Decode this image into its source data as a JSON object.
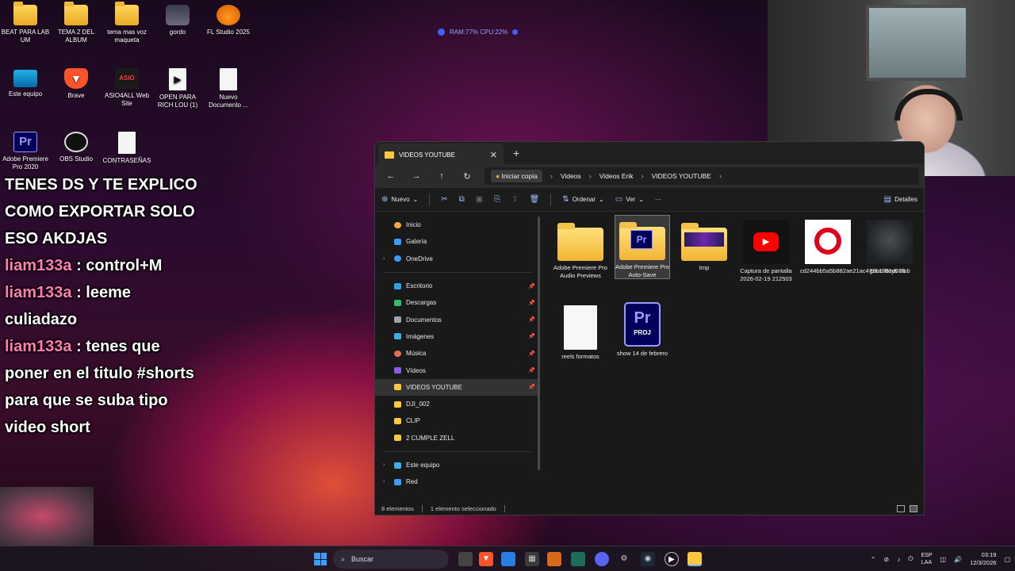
{
  "desktop": {
    "icons": [
      {
        "label": "BEAT PARA LAB UM"
      },
      {
        "label": "TEMA 2 DEL ALBUM"
      },
      {
        "label": "tema mas voz maqueta"
      },
      {
        "label": "gordo"
      },
      {
        "label": "FL Studio 2025"
      },
      {
        "label": "Este equipo"
      },
      {
        "label": "Brave"
      },
      {
        "label": "ASIO4ALL Web Site"
      },
      {
        "label": "OPEN PARA RICH LOU (1)"
      },
      {
        "label": "Nuevo Documento ..."
      },
      {
        "label": "Adobe Premiere Pro 2020"
      },
      {
        "label": "OBS Studio"
      },
      {
        "label": "CONTRASEÑAS"
      }
    ]
  },
  "perf_widget": {
    "text": "RAM:77%  CPU:22%"
  },
  "chat": {
    "lines": [
      {
        "text": "TENES DS Y TE EXPLICO COMO EXPORTAR SOLO ESO AKDJAS"
      },
      {
        "user": "liam133a",
        "text": " : control+M"
      },
      {
        "user": "liam133a",
        "text": " : leeme culiadazo"
      },
      {
        "user": "liam133a",
        "text": " : tenes que poner en el titulo #shorts para que se suba tipo video short"
      }
    ]
  },
  "explorer": {
    "tab_title": "VIDEOS YOUTUBE",
    "new_tab": "+",
    "breadcrumb": [
      "Iniciar copia",
      "Videos",
      "Videos Erik",
      "VIDEOS YOUTUBE"
    ],
    "toolbar": {
      "new_label": "Nuevo",
      "sort_label": "Ordenar",
      "view_label": "Ver",
      "more_label": "···",
      "details_label": "Detalles"
    },
    "nav": {
      "top": [
        {
          "label": "Inicio",
          "color": "#f2a83c"
        },
        {
          "label": "Galería",
          "color": "#3b9cff"
        },
        {
          "label": "OneDrive",
          "color": "#3b9cff"
        }
      ],
      "quick": [
        {
          "label": "Escritorio",
          "color": "#2f9fe8"
        },
        {
          "label": "Descargas",
          "color": "#2fbf6a"
        },
        {
          "label": "Documentos",
          "color": "#9aa4b0"
        },
        {
          "label": "Imágenes",
          "color": "#3bb0e8"
        },
        {
          "label": "Música",
          "color": "#e86a5a"
        },
        {
          "label": "Vídeos",
          "color": "#8a5ae8"
        },
        {
          "label": "VIDEOS YOUTUBE",
          "color": "#ffc83d"
        },
        {
          "label": "DJI_002",
          "color": "#ffc83d"
        },
        {
          "label": "CLIP",
          "color": "#ffc83d"
        },
        {
          "label": "2 CUMPLE ZELL",
          "color": "#ffc83d"
        }
      ],
      "bottom": [
        {
          "label": "Este equipo",
          "color": "#3bb0e8"
        },
        {
          "label": "Red",
          "color": "#3b9cff"
        }
      ]
    },
    "files": [
      {
        "name": "Adobe Premiere Pro Audio Previews"
      },
      {
        "name": "Adobe Premiere Pro Auto-Save"
      },
      {
        "name": "tmp"
      },
      {
        "name": "Captura de pantalla 2026-02-19 212503"
      },
      {
        "name": "cd244bb5a5b882ae21ac472b1981d038"
      },
      {
        "name": "gucci boys club"
      },
      {
        "name": "reels formatos"
      },
      {
        "name": "show 14 de febrero"
      }
    ],
    "status": {
      "count": "8 elementos",
      "selection": "1 elemento seleccionado"
    }
  },
  "taskbar": {
    "search_placeholder": "Buscar",
    "lang_top": "ESP",
    "lang_bottom": "LAA",
    "time": "03:19",
    "date": "12/3/2026"
  }
}
